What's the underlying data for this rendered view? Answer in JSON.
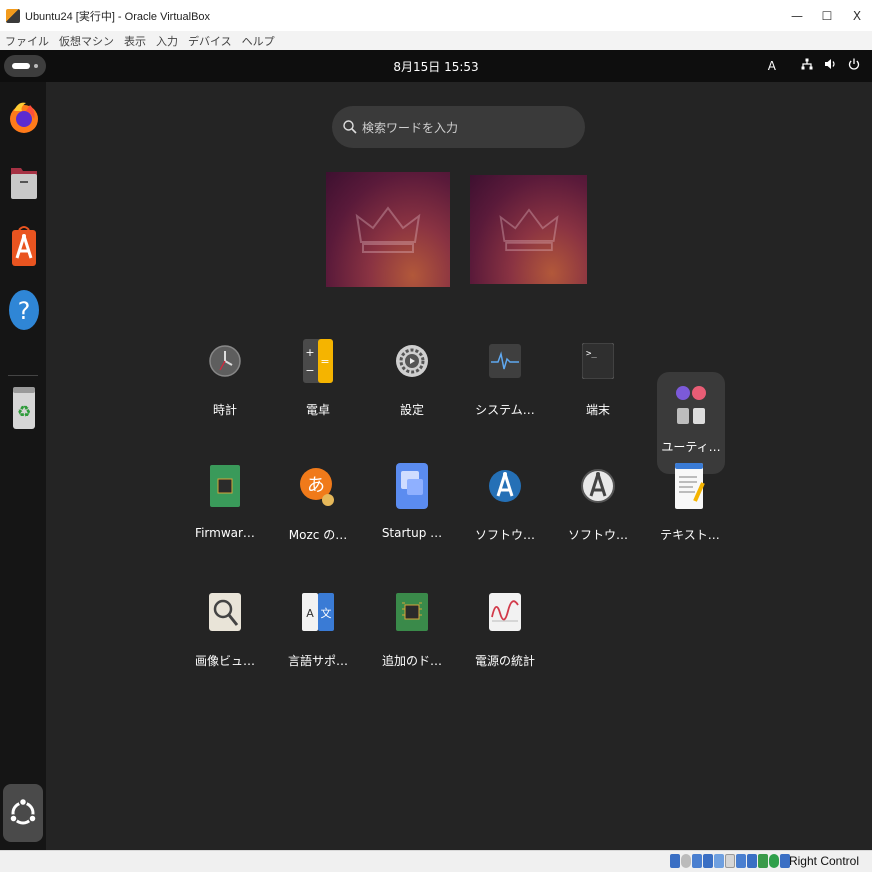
{
  "window": {
    "title": "Ubuntu24 [実行中] - Oracle VirtualBox",
    "minimize": "—",
    "maximize": "☐",
    "close": "X"
  },
  "menubar": [
    "ファイル",
    "仮想マシン",
    "表示",
    "入力",
    "デバイス",
    "ヘルプ"
  ],
  "topbar": {
    "clock": "8月15日  15:53",
    "input_method": "A"
  },
  "dock": [
    "firefox-icon",
    "files-icon",
    "app-center-icon",
    "help-icon",
    "trash-icon",
    "show-apps-icon"
  ],
  "search": {
    "placeholder": "検索ワードを入力"
  },
  "apps": [
    {
      "label": "時計",
      "icon": "clock-icon"
    },
    {
      "label": "電卓",
      "icon": "calculator-icon"
    },
    {
      "label": "設定",
      "icon": "settings-icon"
    },
    {
      "label": "システム…",
      "icon": "system-monitor-icon"
    },
    {
      "label": "端末",
      "icon": "terminal-icon"
    },
    {
      "label": "ユーティ…",
      "icon": "utilities-folder-icon"
    },
    {
      "label": "Firmwar…",
      "icon": "firmware-icon"
    },
    {
      "label": "Mozc の…",
      "icon": "mozc-icon"
    },
    {
      "label": "Startup …",
      "icon": "startup-disk-icon"
    },
    {
      "label": "ソフトウ…",
      "icon": "software-updater-icon"
    },
    {
      "label": "ソフトウ…",
      "icon": "software-properties-icon"
    },
    {
      "label": "テキスト…",
      "icon": "text-editor-icon"
    },
    {
      "label": "画像ビュ…",
      "icon": "image-viewer-icon"
    },
    {
      "label": "言語サポ…",
      "icon": "language-support-icon"
    },
    {
      "label": "追加のド…",
      "icon": "additional-drivers-icon"
    },
    {
      "label": "電源の統計",
      "icon": "power-statistics-icon"
    }
  ],
  "statusbar": {
    "host_key": "Right Control"
  }
}
